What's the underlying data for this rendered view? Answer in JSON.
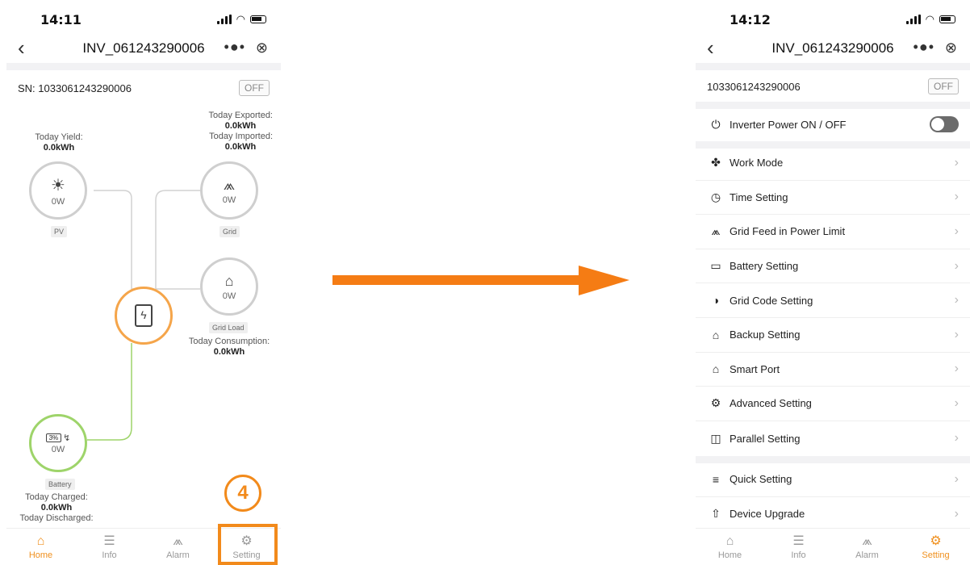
{
  "left": {
    "time": "14:11",
    "title": "INV_061243290006",
    "more": "•●•",
    "close": "⊗",
    "sn": "SN: 1033061243290006",
    "off_label": "OFF",
    "today_exported_label": "Today Exported:",
    "today_exported_value": "0.0kWh",
    "today_imported_label": "Today Imported:",
    "today_imported_value": "0.0kWh",
    "today_yield_label": "Today Yield:",
    "today_yield_value": "0.0kWh",
    "pv_power": "0W",
    "pv_label": "PV",
    "grid_power": "0W",
    "grid_label": "Grid",
    "load_power": "0W",
    "load_label": "Grid Load",
    "today_consumption_label": "Today Consumption:",
    "today_consumption_value": "0.0kWh",
    "battery_percent": "3%",
    "battery_power": "0W",
    "battery_label": "Battery",
    "today_charged_label": "Today Charged:",
    "today_charged_value": "0.0kWh",
    "today_discharged_label": "Today Discharged:",
    "callout_number": "4",
    "tabs": [
      {
        "label": "Home",
        "icon": "home-icon"
      },
      {
        "label": "Info",
        "icon": "info-icon"
      },
      {
        "label": "Alarm",
        "icon": "alarm-icon"
      },
      {
        "label": "Setting",
        "icon": "gear-icon"
      }
    ]
  },
  "right": {
    "time": "14:12",
    "title": "INV_061243290006",
    "more": "•●•",
    "close": "⊗",
    "sn": "1033061243290006",
    "off_label": "OFF",
    "power_toggle_label": "Inverter Power ON / OFF",
    "menu": [
      {
        "label": "Work Mode",
        "icon": "work-mode-icon"
      },
      {
        "label": "Time Setting",
        "icon": "clock-icon"
      },
      {
        "label": "Grid Feed in Power Limit",
        "icon": "grid-tower-icon"
      },
      {
        "label": "Battery Setting",
        "icon": "battery-icon"
      },
      {
        "label": "Grid Code Setting",
        "icon": "grid-code-icon"
      },
      {
        "label": "Backup Setting",
        "icon": "backup-icon"
      },
      {
        "label": "Smart Port",
        "icon": "smart-port-icon"
      },
      {
        "label": "Advanced Setting",
        "icon": "advanced-gear-icon"
      },
      {
        "label": "Parallel Setting",
        "icon": "parallel-icon"
      }
    ],
    "menu2": [
      {
        "label": "Quick Setting",
        "icon": "sliders-icon"
      },
      {
        "label": "Device Upgrade",
        "icon": "upgrade-icon"
      }
    ],
    "tabs": [
      {
        "label": "Home",
        "icon": "home-icon"
      },
      {
        "label": "Info",
        "icon": "info-icon"
      },
      {
        "label": "Alarm",
        "icon": "alarm-icon"
      },
      {
        "label": "Setting",
        "icon": "gear-icon"
      }
    ]
  },
  "colors": {
    "accent": "#f0901e",
    "arrow": "#f57c14",
    "battery_green": "#9ed46a",
    "inverter_orange": "#f5a54a"
  }
}
